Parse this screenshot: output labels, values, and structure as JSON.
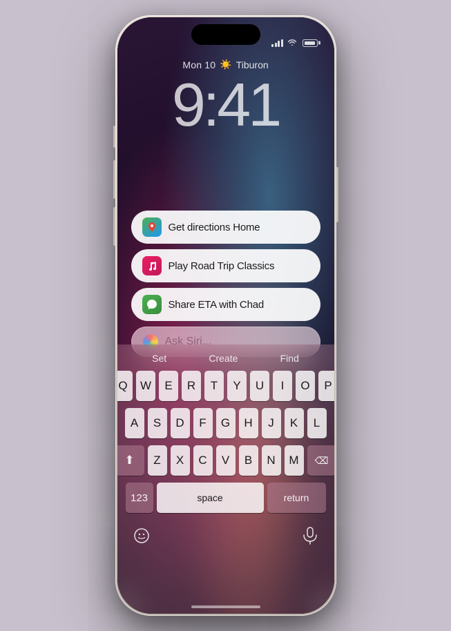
{
  "phone": {
    "statusBar": {
      "signal": "signal-icon",
      "wifi": "wifi-icon",
      "battery": "battery-icon"
    },
    "lockScreen": {
      "dateWeather": "Mon 10",
      "weatherIcon": "☀️",
      "location": "Tiburon",
      "time": "9:41"
    },
    "suggestions": [
      {
        "id": "directions",
        "icon": "🗺️",
        "iconType": "maps",
        "text": "Get directions Home"
      },
      {
        "id": "music",
        "icon": "🎵",
        "iconType": "music",
        "text": "Play Road Trip Classics"
      },
      {
        "id": "messages",
        "icon": "💬",
        "iconType": "messages",
        "text": "Share ETA with Chad"
      }
    ],
    "siri": {
      "placeholder": "Ask Siri..."
    },
    "keyboard": {
      "quicktype": [
        "Set",
        "Create",
        "Find"
      ],
      "rows": [
        [
          "Q",
          "W",
          "E",
          "R",
          "T",
          "Y",
          "U",
          "I",
          "O",
          "P"
        ],
        [
          "A",
          "S",
          "D",
          "F",
          "G",
          "H",
          "J",
          "K",
          "L"
        ],
        [
          "⇧",
          "Z",
          "X",
          "C",
          "V",
          "B",
          "N",
          "M",
          "⌫"
        ],
        [
          "123",
          "space",
          "return"
        ]
      ]
    },
    "homeIndicator": true
  }
}
